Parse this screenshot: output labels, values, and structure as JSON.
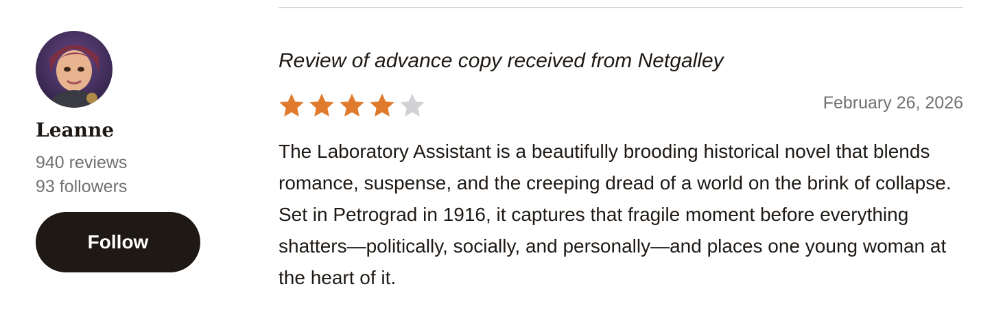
{
  "reviewer": {
    "name": "Leanne",
    "reviews": "940 reviews",
    "followers": "93 followers",
    "follow_label": "Follow",
    "avatar_icon": "avatar-illustration"
  },
  "review": {
    "title": "Review of advance copy received from Netgalley",
    "rating": 4,
    "rating_max": 5,
    "date": "February 26, 2026",
    "body": "The Laboratory Assistant is a beautifully brooding historical novel that blends romance, suspense, and the creeping dread of a world on the brink of collapse. Set in Petrograd in 1916, it captures that fragile moment before everything shatters—politically, socially, and personally—and places one young woman at the heart of it."
  },
  "colors": {
    "star_filled": "#e07a2c",
    "star_empty": "#d2d2d6",
    "button_bg": "#1e1915",
    "muted_text": "#707070"
  }
}
